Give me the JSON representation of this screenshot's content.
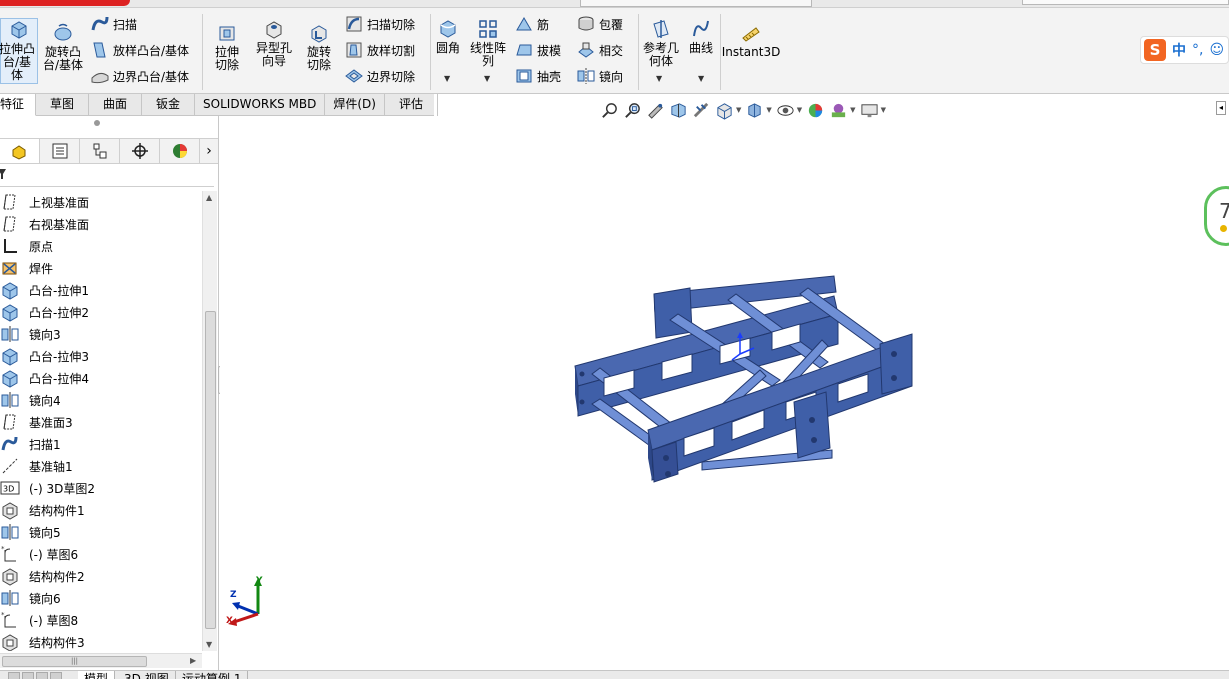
{
  "ribbon": {
    "extrude_boss": "拉伸凸台/基体",
    "revolve_boss": "旋转凸台/基体",
    "sweep": "扫描",
    "loft_boss": "放样凸台/基体",
    "boundary_boss": "边界凸台/基体",
    "extrude_cut": "拉伸切除",
    "hole_wizard": "异型孔向导",
    "revolve_cut": "旋转切除",
    "swept_cut": "扫描切除",
    "lofted_cut": "放样切割",
    "boundary_cut": "边界切除",
    "fillet": "圆角",
    "linear_pattern": "线性阵列",
    "rib": "筋",
    "draft": "拔模",
    "shell": "抽壳",
    "wrap": "包覆",
    "intersect": "相交",
    "mirror": "镜向",
    "ref_geometry": "参考几何体",
    "curves": "曲线",
    "instant3d": "Instant3D"
  },
  "ime": {
    "logo": "S",
    "lang": "中",
    "punct": "°,",
    "emoji": "☺"
  },
  "tabs": [
    "特征",
    "草图",
    "曲面",
    "钣金",
    "SOLIDWORKS MBD",
    "焊件(D)",
    "评估"
  ],
  "tree": [
    {
      "label": "上视基准面",
      "icon": "plane-icon"
    },
    {
      "label": "右视基准面",
      "icon": "plane-icon"
    },
    {
      "label": "原点",
      "icon": "origin-icon"
    },
    {
      "label": "焊件",
      "icon": "weldment-icon"
    },
    {
      "label": "凸台-拉伸1",
      "icon": "extrude-icon"
    },
    {
      "label": "凸台-拉伸2",
      "icon": "extrude-icon"
    },
    {
      "label": "镜向3",
      "icon": "mirror-icon"
    },
    {
      "label": "凸台-拉伸3",
      "icon": "extrude-icon"
    },
    {
      "label": "凸台-拉伸4",
      "icon": "extrude-icon"
    },
    {
      "label": "镜向4",
      "icon": "mirror-icon"
    },
    {
      "label": "基准面3",
      "icon": "plane-icon"
    },
    {
      "label": "扫描1",
      "icon": "sweep-icon"
    },
    {
      "label": "基准轴1",
      "icon": "axis-icon"
    },
    {
      "label": "(-) 3D草图2",
      "icon": "3d-sketch-icon"
    },
    {
      "label": "结构构件1",
      "icon": "structural-member-icon"
    },
    {
      "label": "镜向5",
      "icon": "mirror-icon"
    },
    {
      "label": "(-) 草图6",
      "icon": "sketch-icon"
    },
    {
      "label": "结构构件2",
      "icon": "structural-member-icon"
    },
    {
      "label": "镜向6",
      "icon": "mirror-icon"
    },
    {
      "label": "(-) 草图8",
      "icon": "sketch-icon"
    },
    {
      "label": "结构构件3",
      "icon": "structural-member-icon"
    }
  ],
  "triad": {
    "x": "X",
    "y": "Y",
    "z": "Z"
  },
  "rebuild_indicator": "7",
  "bottom_tabs": [
    "模型",
    "3D 视图",
    "运动算例 1"
  ],
  "colors": {
    "model": "#3f5fa8",
    "model_dark": "#22386f",
    "accent": "#5cc05c"
  }
}
